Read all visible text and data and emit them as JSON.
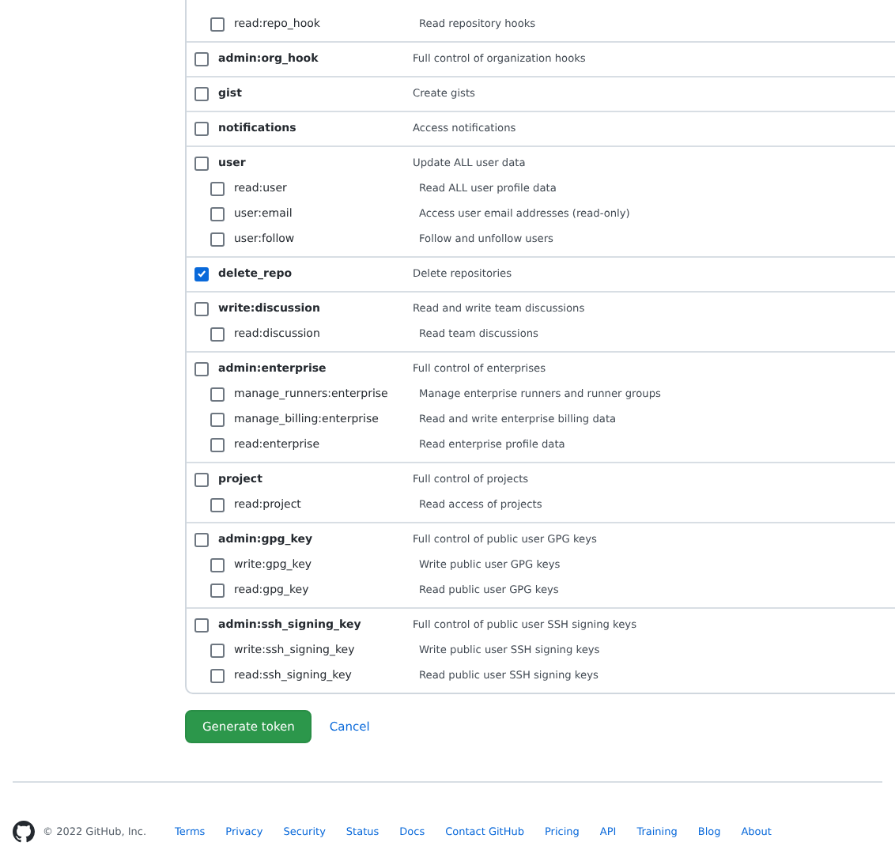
{
  "scope_groups": [
    {
      "children": [
        {
          "scope": "read:repo_hook",
          "description": "Read repository hooks",
          "checked": false
        }
      ]
    },
    {
      "scope": "admin:org_hook",
      "description": "Full control of organization hooks",
      "checked": false
    },
    {
      "scope": "gist",
      "description": "Create gists",
      "checked": false
    },
    {
      "scope": "notifications",
      "description": "Access notifications",
      "checked": false
    },
    {
      "scope": "user",
      "description": "Update ALL user data",
      "checked": false,
      "children": [
        {
          "scope": "read:user",
          "description": "Read ALL user profile data",
          "checked": false
        },
        {
          "scope": "user:email",
          "description": "Access user email addresses (read-only)",
          "checked": false
        },
        {
          "scope": "user:follow",
          "description": "Follow and unfollow users",
          "checked": false
        }
      ]
    },
    {
      "scope": "delete_repo",
      "description": "Delete repositories",
      "checked": true
    },
    {
      "scope": "write:discussion",
      "description": "Read and write team discussions",
      "checked": false,
      "children": [
        {
          "scope": "read:discussion",
          "description": "Read team discussions",
          "checked": false
        }
      ]
    },
    {
      "scope": "admin:enterprise",
      "description": "Full control of enterprises",
      "checked": false,
      "children": [
        {
          "scope": "manage_runners:enterprise",
          "description": "Manage enterprise runners and runner groups",
          "checked": false
        },
        {
          "scope": "manage_billing:enterprise",
          "description": "Read and write enterprise billing data",
          "checked": false
        },
        {
          "scope": "read:enterprise",
          "description": "Read enterprise profile data",
          "checked": false
        }
      ]
    },
    {
      "scope": "project",
      "description": "Full control of projects",
      "checked": false,
      "children": [
        {
          "scope": "read:project",
          "description": "Read access of projects",
          "checked": false
        }
      ]
    },
    {
      "scope": "admin:gpg_key",
      "description": "Full control of public user GPG keys",
      "checked": false,
      "children": [
        {
          "scope": "write:gpg_key",
          "description": "Write public user GPG keys",
          "checked": false
        },
        {
          "scope": "read:gpg_key",
          "description": "Read public user GPG keys",
          "checked": false
        }
      ]
    },
    {
      "scope": "admin:ssh_signing_key",
      "description": "Full control of public user SSH signing keys",
      "checked": false,
      "children": [
        {
          "scope": "write:ssh_signing_key",
          "description": "Write public user SSH signing keys",
          "checked": false
        },
        {
          "scope": "read:ssh_signing_key",
          "description": "Read public user SSH signing keys",
          "checked": false
        }
      ]
    }
  ],
  "buttons": {
    "primary": "Generate token",
    "cancel": "Cancel"
  },
  "footer": {
    "copyright": "© 2022 GitHub, Inc.",
    "links": [
      "Terms",
      "Privacy",
      "Security",
      "Status",
      "Docs",
      "Contact GitHub",
      "Pricing",
      "API",
      "Training",
      "Blog",
      "About"
    ]
  }
}
